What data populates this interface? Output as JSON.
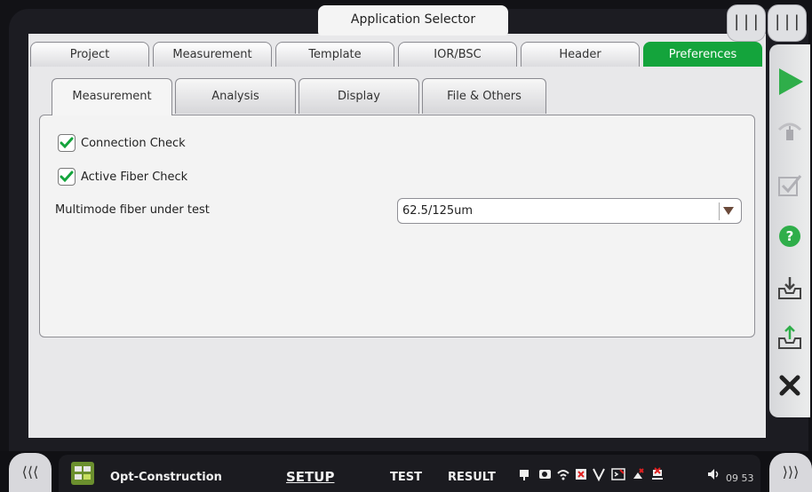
{
  "app_title": "Application Selector",
  "main_tabs": [
    {
      "label": "Project",
      "active": false
    },
    {
      "label": "Measurement",
      "active": false
    },
    {
      "label": "Template",
      "active": false
    },
    {
      "label": "IOR/BSC",
      "active": false
    },
    {
      "label": "Header",
      "active": false
    },
    {
      "label": "Preferences",
      "active": true
    }
  ],
  "sub_tabs": [
    {
      "label": "Measurement",
      "active": true
    },
    {
      "label": "Analysis",
      "active": false
    },
    {
      "label": "Display",
      "active": false
    },
    {
      "label": "File & Others",
      "active": false
    }
  ],
  "options": {
    "connection_check": {
      "label": "Connection Check",
      "checked": true
    },
    "active_fiber_check": {
      "label": "Active Fiber Check",
      "checked": true
    }
  },
  "multimode": {
    "label": "Multimode fiber under test",
    "value": "62.5/125um"
  },
  "bottom": {
    "app_name": "Opt-Construction",
    "setup": "SETUP",
    "test": "TEST",
    "result": "RESULT",
    "clock": "09 53"
  },
  "colors": {
    "accent": "#14a43c",
    "stop": "#222222"
  },
  "icons": [
    "toggle-left-icon",
    "toggle-right-icon",
    "play-icon",
    "remote-icon",
    "check-icon",
    "help-icon",
    "import-icon",
    "export-icon",
    "close-icon"
  ]
}
